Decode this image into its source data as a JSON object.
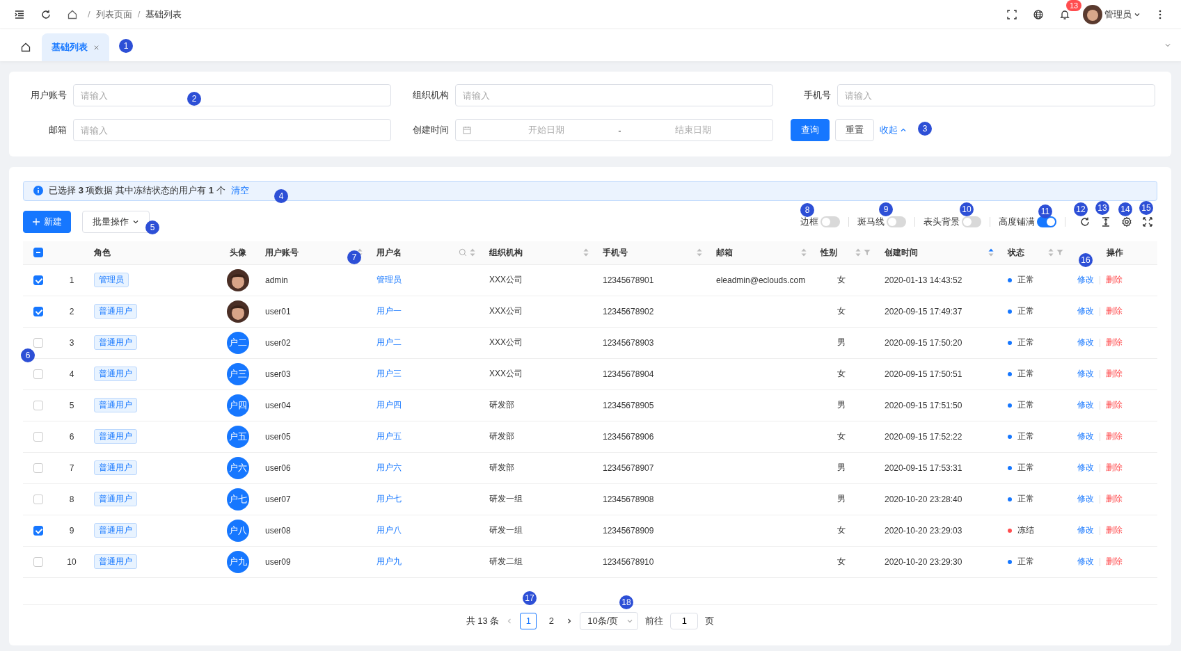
{
  "topbar": {
    "separator": "/",
    "breadcrumb": [
      "列表页面",
      "基础列表"
    ],
    "notifications": "13",
    "user": "管理员"
  },
  "tabs": [
    {
      "label": "基础列表",
      "selected": true
    }
  ],
  "search": {
    "fields": [
      {
        "label": "用户账号",
        "kind": "text",
        "placeholder": "请输入"
      },
      {
        "label": "组织机构",
        "kind": "text",
        "placeholder": "请输入"
      },
      {
        "label": "手机号",
        "kind": "text",
        "placeholder": "请输入"
      },
      {
        "label": "邮箱",
        "kind": "text",
        "placeholder": "请输入"
      },
      {
        "label": "创建时间",
        "kind": "daterange",
        "start": "开始日期",
        "separator": "-",
        "end": "结束日期"
      }
    ],
    "buttons": [
      {
        "label": "查询",
        "kind": "primary"
      },
      {
        "label": "重置",
        "kind": "default"
      }
    ],
    "collapse": "收起"
  },
  "alert": {
    "text": "已选择 **3** 项数据 其中冻结状态的用户有 **1** 个",
    "link": "清空"
  },
  "toolbar": {
    "add": "新建",
    "batch": "批量操作",
    "switches": [
      {
        "label": "边框",
        "on": false
      },
      {
        "label": "斑马线",
        "on": false
      },
      {
        "label": "表头背景",
        "on": false
      },
      {
        "label": "高度铺满",
        "on": true
      }
    ]
  },
  "table": {
    "select_all": {
      "indeterminate": true
    },
    "columns": [
      {
        "label": "角色"
      },
      {
        "label": "头像"
      },
      {
        "label": "用户账号",
        "sortable": true
      },
      {
        "label": "用户名",
        "sortable": true,
        "search": true
      },
      {
        "label": "组织机构",
        "sortable": true
      },
      {
        "label": "手机号",
        "sortable": true
      },
      {
        "label": "邮箱",
        "sortable": true
      },
      {
        "label": "性别",
        "sortable": true,
        "filter": true
      },
      {
        "label": "创建时间",
        "sortable": true,
        "sorted_ascending": true
      },
      {
        "label": "状态",
        "sortable": true,
        "filter": true
      },
      {
        "label": "操作"
      }
    ],
    "rows": [
      {
        "selected": true,
        "index": "1",
        "role": "管理员",
        "avatar": {
          "kind": "photo"
        },
        "account": "admin",
        "username": "管理员",
        "org": "XXX公司",
        "phone": "12345678901",
        "email": "eleadmin@eclouds.com",
        "gender": "女",
        "created": "2020-01-13 14:43:52",
        "status": {
          "text": "正常",
          "color": "#1677ff"
        },
        "edit": "修改",
        "delete": "删除"
      },
      {
        "selected": true,
        "index": "2",
        "role": "普通用户",
        "avatar": {
          "kind": "photo"
        },
        "account": "user01",
        "username": "用户一",
        "org": "XXX公司",
        "phone": "12345678902",
        "gender": "女",
        "created": "2020-09-15 17:49:37",
        "status": {
          "text": "正常",
          "color": "#1677ff"
        },
        "edit": "修改",
        "delete": "删除"
      },
      {
        "selected": false,
        "index": "3",
        "role": "普通用户",
        "avatar": {
          "kind": "text",
          "text": "户二"
        },
        "account": "user02",
        "username": "用户二",
        "org": "XXX公司",
        "phone": "12345678903",
        "gender": "男",
        "created": "2020-09-15 17:50:20",
        "status": {
          "text": "正常",
          "color": "#1677ff"
        },
        "edit": "修改",
        "delete": "删除"
      },
      {
        "selected": false,
        "index": "4",
        "role": "普通用户",
        "avatar": {
          "kind": "text",
          "text": "户三"
        },
        "account": "user03",
        "username": "用户三",
        "org": "XXX公司",
        "phone": "12345678904",
        "gender": "女",
        "created": "2020-09-15 17:50:51",
        "status": {
          "text": "正常",
          "color": "#1677ff"
        },
        "edit": "修改",
        "delete": "删除"
      },
      {
        "selected": false,
        "index": "5",
        "role": "普通用户",
        "avatar": {
          "kind": "text",
          "text": "户四"
        },
        "account": "user04",
        "username": "用户四",
        "org": "研发部",
        "phone": "12345678905",
        "gender": "男",
        "created": "2020-09-15 17:51:50",
        "status": {
          "text": "正常",
          "color": "#1677ff"
        },
        "edit": "修改",
        "delete": "删除"
      },
      {
        "selected": false,
        "index": "6",
        "role": "普通用户",
        "avatar": {
          "kind": "text",
          "text": "户五"
        },
        "account": "user05",
        "username": "用户五",
        "org": "研发部",
        "phone": "12345678906",
        "gender": "女",
        "created": "2020-09-15 17:52:22",
        "status": {
          "text": "正常",
          "color": "#1677ff"
        },
        "edit": "修改",
        "delete": "删除"
      },
      {
        "selected": false,
        "index": "7",
        "role": "普通用户",
        "avatar": {
          "kind": "text",
          "text": "户六"
        },
        "account": "user06",
        "username": "用户六",
        "org": "研发部",
        "phone": "12345678907",
        "gender": "男",
        "created": "2020-09-15 17:53:31",
        "status": {
          "text": "正常",
          "color": "#1677ff"
        },
        "edit": "修改",
        "delete": "删除"
      },
      {
        "selected": false,
        "index": "8",
        "role": "普通用户",
        "avatar": {
          "kind": "text",
          "text": "户七"
        },
        "account": "user07",
        "username": "用户七",
        "org": "研发一组",
        "phone": "12345678908",
        "gender": "男",
        "created": "2020-10-20 23:28:40",
        "status": {
          "text": "正常",
          "color": "#1677ff"
        },
        "edit": "修改",
        "delete": "删除"
      },
      {
        "selected": true,
        "index": "9",
        "role": "普通用户",
        "avatar": {
          "kind": "text",
          "text": "户八"
        },
        "account": "user08",
        "username": "用户八",
        "org": "研发一组",
        "phone": "12345678909",
        "gender": "女",
        "created": "2020-10-20 23:29:03",
        "status": {
          "text": "冻结",
          "color": "#ff4d4f"
        },
        "edit": "修改",
        "delete": "删除"
      },
      {
        "selected": false,
        "index": "10",
        "role": "普通用户",
        "avatar": {
          "kind": "text",
          "text": "户九"
        },
        "account": "user09",
        "username": "用户九",
        "org": "研发二组",
        "phone": "12345678910",
        "gender": "女",
        "created": "2020-10-20 23:29:30",
        "status": {
          "text": "正常",
          "color": "#1677ff"
        },
        "edit": "修改",
        "delete": "删除"
      }
    ]
  },
  "pagination": {
    "total": "共 13 条",
    "pages": [
      {
        "label": "1",
        "selected": true
      },
      {
        "label": "2",
        "selected": false
      }
    ],
    "page_size": "10条/页",
    "goto": "前往",
    "goto_value": "1",
    "unit": "页"
  },
  "callouts": [
    "1",
    "2",
    "3",
    "4",
    "5",
    "6",
    "7",
    "8",
    "9",
    "10",
    "11",
    "12",
    "13",
    "14",
    "15",
    "16",
    "17",
    "18"
  ]
}
